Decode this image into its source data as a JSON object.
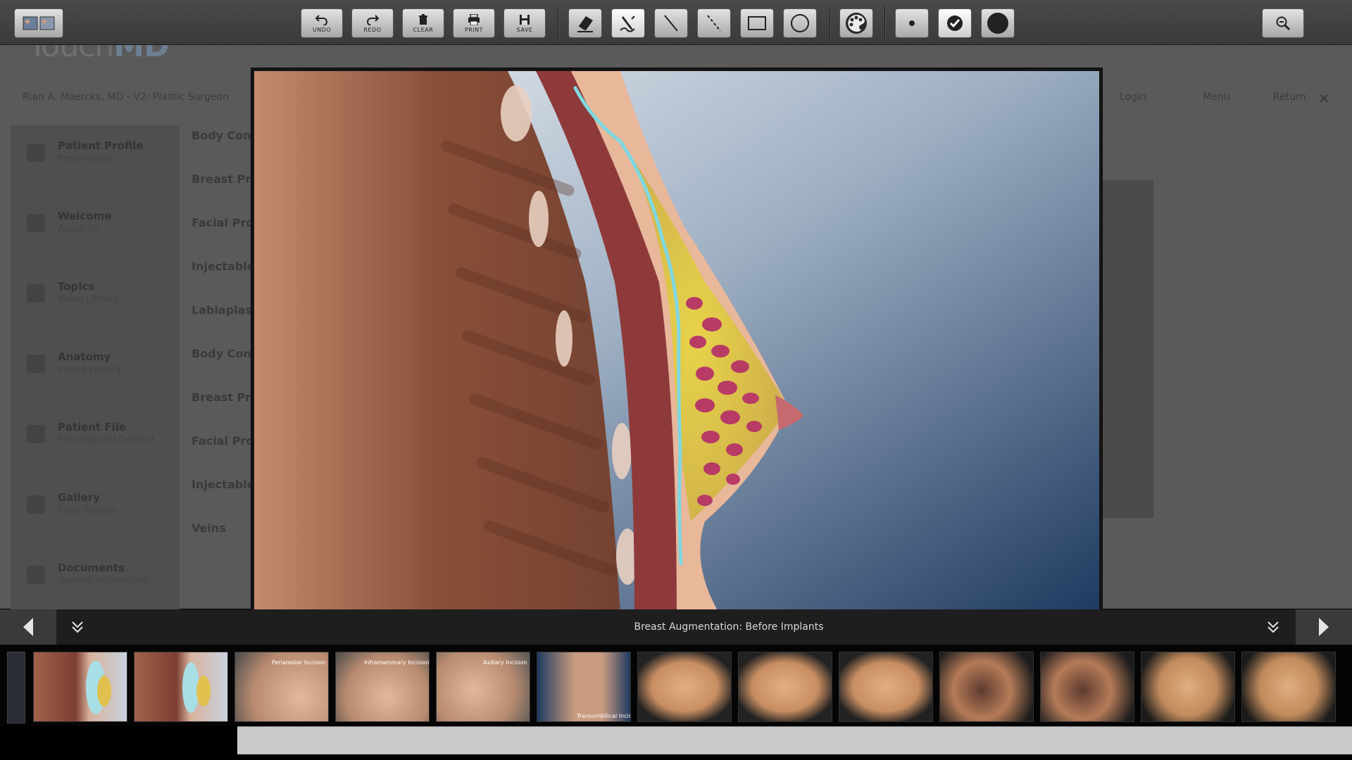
{
  "app": {
    "logo_prefix": "Touch",
    "logo_suffix": "MD",
    "doctor": "Rian A. Maercks, MD - V2: Plastic Surgeon",
    "top_links": [
      "Login",
      "Menu",
      "Return"
    ]
  },
  "left_nav": [
    {
      "title": "Patient Profile",
      "subtitle": "Preferences"
    },
    {
      "title": "Welcome",
      "subtitle": "About Us"
    },
    {
      "title": "Topics",
      "subtitle": "Video Library"
    },
    {
      "title": "Anatomy",
      "subtitle": "Image Library"
    },
    {
      "title": "Patient File",
      "subtitle": "Personalized Content"
    },
    {
      "title": "Gallery",
      "subtitle": "Case Studies"
    },
    {
      "title": "Documents",
      "subtitle": "General Information"
    }
  ],
  "categories": [
    "Body Cont",
    "Breast Pro",
    "Facial Pro",
    "Injectable",
    "Labiaplast",
    "Body Cont",
    "Breast Pro",
    "Facial Pro",
    "Injectable",
    "Veins"
  ],
  "toolbar": {
    "undo": "UNDO",
    "redo": "REDO",
    "clear": "CLEAR",
    "print": "PRINT",
    "save": "SAVE"
  },
  "viewer": {
    "caption": "Breast Augmentation: Before Implants",
    "annotation_color": "#7fd8e0"
  },
  "thumbnails": [
    {
      "caption": ""
    },
    {
      "caption": ""
    },
    {
      "caption": "Periareolar Incision"
    },
    {
      "caption": "Inframammary Incision"
    },
    {
      "caption": "Axillary Incision"
    },
    {
      "caption": "Transumbilical Incision"
    },
    {
      "caption": ""
    },
    {
      "caption": ""
    },
    {
      "caption": ""
    },
    {
      "caption": ""
    },
    {
      "caption": ""
    },
    {
      "caption": ""
    },
    {
      "caption": ""
    }
  ],
  "colors": {
    "toolbar": "#3a3a3a",
    "bar": "#1e1e1e",
    "track": "#c9c9c9"
  }
}
